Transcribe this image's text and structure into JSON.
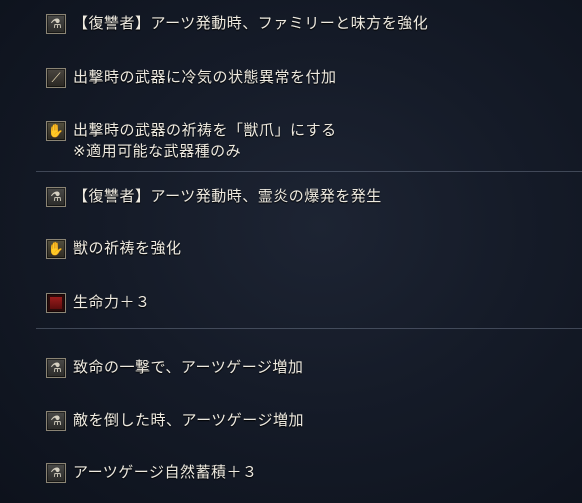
{
  "effects": [
    {
      "icon": "flask-icon",
      "glyph": "⚗",
      "text": "【復讐者】アーツ発動時、ファミリーと味方を強化"
    },
    {
      "icon": "blade-icon",
      "glyph": "⟋",
      "text": "出撃時の武器に冷気の状態異常を付加"
    },
    {
      "icon": "scroll-icon",
      "glyph": "✋",
      "text": "出撃時の武器の祈祷を「獣爪」にする",
      "note": "※適用可能な武器種のみ"
    },
    {
      "icon": "flask-icon",
      "glyph": "⚗",
      "text": "【復讐者】アーツ発動時、霊炎の爆発を発生"
    },
    {
      "icon": "scroll-icon",
      "glyph": "✋",
      "text": "獣の祈祷を強化"
    },
    {
      "icon": "red-square-icon",
      "glyph": "",
      "text": "生命力＋３"
    },
    {
      "icon": "flask-icon",
      "glyph": "⚗",
      "text": "致命の一撃で、アーツゲージ増加"
    },
    {
      "icon": "flask-icon",
      "glyph": "⚗",
      "text": "敵を倒した時、アーツゲージ増加"
    },
    {
      "icon": "flask-icon",
      "glyph": "⚗",
      "text": "アーツゲージ自然蓄積＋３"
    }
  ]
}
